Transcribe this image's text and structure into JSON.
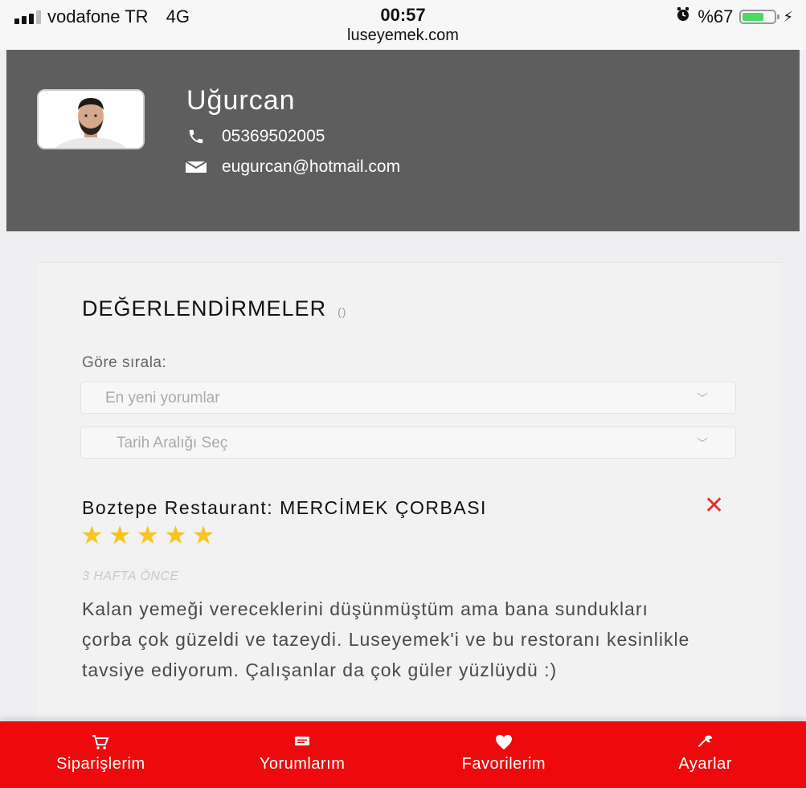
{
  "status_bar": {
    "carrier": "vodafone TR",
    "network": "4G",
    "time": "00:57",
    "url": "luseyemek.com",
    "battery_percent": "%67",
    "battery_level": 0.67,
    "battery_color": "#4cd964"
  },
  "profile": {
    "name": "Uğurcan",
    "phone": "05369502005",
    "email": "eugurcan@hotmail.com",
    "background_color": "#5e5e5f"
  },
  "reviews_section": {
    "title": "DEĞERLENDİRMELER",
    "count": "()",
    "sort_label": "Göre sırala:",
    "sort_select": {
      "selected": "En yeni yorumlar"
    },
    "date_range_select": {
      "placeholder": "Tarih Aralığı Seç"
    }
  },
  "reviews": [
    {
      "title": "Boztepe Restaurant: MERCİMEK ÇORBASI",
      "rating": 5,
      "rating_max": 5,
      "date": "3 HAFTA ÖNCE",
      "text": "Kalan yemeği vereceklerini düşünmüştüm ama bana sundukları çorba çok güzeldi ve tazeydi. Luseyemek'i ve bu restoranı kesinlikle tavsiye ediyorum. Çalışanlar da çok güler yüzlüydü :)"
    }
  ],
  "bottom_nav": {
    "background_color": "#ee0a0c",
    "items": [
      {
        "label": "Siparişlerim",
        "icon": "cart-icon"
      },
      {
        "label": "Yorumlarım",
        "icon": "comment-icon"
      },
      {
        "label": "Favorilerim",
        "icon": "heart-icon"
      },
      {
        "label": "Ayarlar",
        "icon": "wrench-icon"
      }
    ]
  },
  "colors": {
    "accent_red": "#e4322b",
    "star_yellow": "#f6c51f"
  }
}
